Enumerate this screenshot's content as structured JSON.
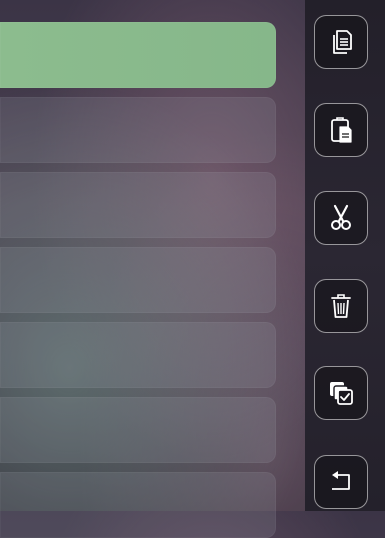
{
  "list": {
    "items": [
      {
        "selected": true
      },
      {
        "selected": false
      },
      {
        "selected": false
      },
      {
        "selected": false
      },
      {
        "selected": false
      },
      {
        "selected": false
      },
      {
        "selected": false
      }
    ]
  },
  "toolbar": {
    "buttons": [
      {
        "icon": "copy-icon"
      },
      {
        "icon": "paste-icon"
      },
      {
        "icon": "cut-icon"
      },
      {
        "icon": "trash-icon"
      },
      {
        "icon": "select-all-icon"
      },
      {
        "icon": "back-icon"
      }
    ]
  },
  "colors": {
    "selected": "#8cbc8e",
    "button_border": "#d9d9d9",
    "icon": "#ffffff"
  }
}
